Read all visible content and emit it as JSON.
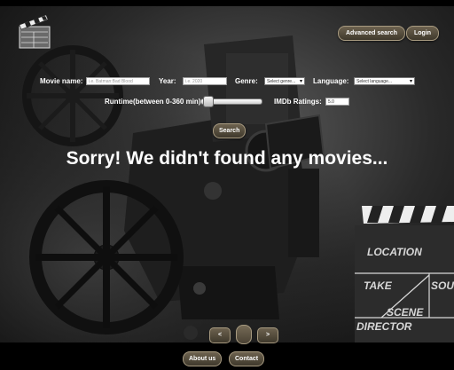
{
  "header": {
    "advanced_search_label": "Advanced search",
    "login_label": "Login"
  },
  "search_form": {
    "movie_name_label": "Movie name:",
    "movie_name_placeholder": "i.e. Batman:Bad Blood",
    "year_label": "Year:",
    "year_placeholder": "i.e. 2020",
    "genre_label": "Genre:",
    "genre_selected": "Select genre...",
    "language_label": "Language:",
    "language_selected": "Select language...",
    "runtime_label": "Runtime(between 0-360 min):",
    "runtime_value_fraction": 0.02,
    "imdb_label": "IMDb Ratings:",
    "imdb_value": "5.0",
    "search_label": "Search"
  },
  "result": {
    "message": "Sorry! We didn't found any movies..."
  },
  "pager": {
    "prev_label": "<",
    "next_label": ">"
  },
  "footer": {
    "about_label": "About us",
    "contact_label": "Contact"
  },
  "background": {
    "clapper_location": "LOCATION",
    "clapper_take": "TAKE",
    "clapper_sou": "SOU",
    "clapper_scene": "SCENE",
    "clapper_director": "DIRECTOR"
  },
  "icons": {
    "logo": "clapperboard-icon",
    "prev": "chevron-left-icon",
    "next": "chevron-right-icon"
  },
  "colors": {
    "button_top": "#6d624f",
    "button_bottom": "#3f392c",
    "button_border": "#a79a80",
    "page_bg": "#000000"
  }
}
